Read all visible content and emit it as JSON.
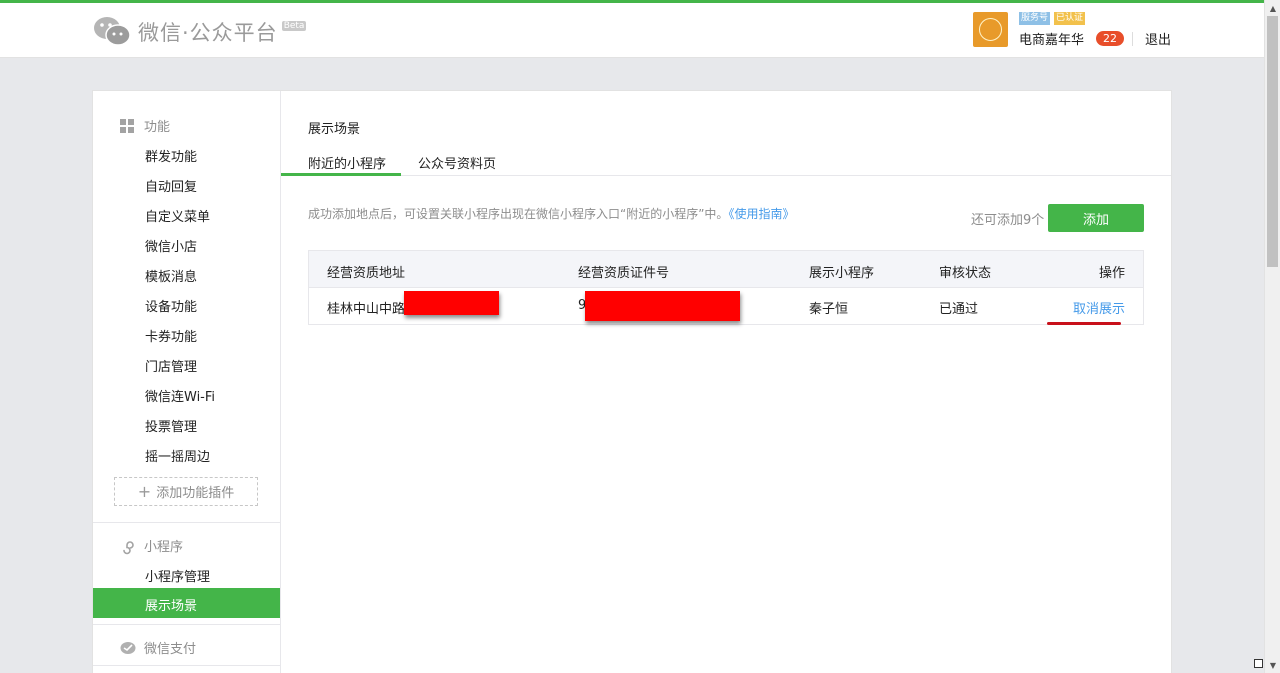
{
  "header": {
    "logo_title": "微信·公众平台",
    "beta_label": "Beta",
    "account": {
      "avatar_text": "电商嘉年华",
      "tag_service": "服务号",
      "tag_verified": "已认证",
      "name": "电商嘉年华",
      "badge_count": "22",
      "logout_label": "退出"
    }
  },
  "sidebar": {
    "group_function": "功能",
    "function_items": [
      "群发功能",
      "自动回复",
      "自定义菜单",
      "微信小店",
      "模板消息",
      "设备功能",
      "卡券功能",
      "门店管理",
      "微信连Wi-Fi",
      "投票管理",
      "摇一摇周边"
    ],
    "add_plugin_label": "添加功能插件",
    "group_miniprogram": "小程序",
    "miniprogram_items": [
      "小程序管理",
      "展示场景"
    ],
    "active_item": "展示场景",
    "group_pay": "微信支付"
  },
  "main": {
    "page_title": "展示场景",
    "tabs": [
      "附近的小程序",
      "公众号资料页"
    ],
    "info_text": "成功添加地点后，可设置关联小程序出现在微信小程序入口“附近的小程序”中。",
    "info_link": "《使用指南》",
    "remain_text": "还可添加9个",
    "add_button": "添加",
    "table": {
      "headers": [
        "经营资质地址",
        "经营资质证件号",
        "展示小程序",
        "审核状态",
        "操作"
      ],
      "rows": [
        {
          "address": "桂林中山中路",
          "license": "9",
          "miniprogram": "秦子恒",
          "status": "已通过",
          "action": "取消展示"
        }
      ]
    }
  },
  "colors": {
    "accent_green": "#44b549",
    "link_blue": "#459ae9",
    "redaction_red": "#ff0000",
    "badge_red": "#e84e2a"
  },
  "icons": {
    "logo": "wechat-logo-icon",
    "function_group": "grid-icon",
    "miniprogram_group": "miniprogram-icon",
    "pay_group": "wechat-pay-icon"
  }
}
